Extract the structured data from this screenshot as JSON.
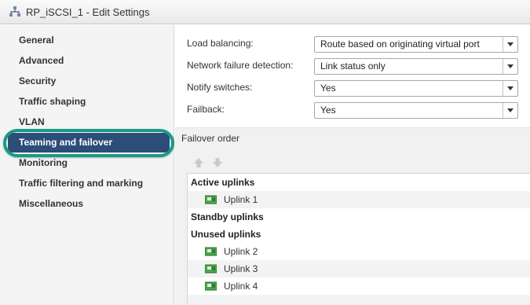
{
  "window": {
    "title": "RP_iSCSI_1 - Edit Settings",
    "icon": "network-portgroup-icon"
  },
  "sidebar": {
    "items": [
      {
        "label": "General"
      },
      {
        "label": "Advanced"
      },
      {
        "label": "Security"
      },
      {
        "label": "Traffic shaping"
      },
      {
        "label": "VLAN"
      },
      {
        "label": "Teaming and failover",
        "selected": true
      },
      {
        "label": "Monitoring"
      },
      {
        "label": "Traffic filtering and marking"
      },
      {
        "label": "Miscellaneous"
      }
    ],
    "selected_color": "#2b4d78",
    "highlight_color": "#1a9a86"
  },
  "settings": {
    "load_balancing": {
      "label": "Load balancing:",
      "value": "Route based on originating virtual port"
    },
    "network_failure_detection": {
      "label": "Network failure detection:",
      "value": "Link status only"
    },
    "notify_switches": {
      "label": "Notify switches:",
      "value": "Yes"
    },
    "failback": {
      "label": "Failback:",
      "value": "Yes"
    }
  },
  "failover": {
    "title": "Failover order",
    "move_up_icon": "arrow-up-icon",
    "move_down_icon": "arrow-down-icon",
    "groups": {
      "active": {
        "label": "Active uplinks",
        "uplinks": [
          "Uplink 1"
        ]
      },
      "standby": {
        "label": "Standby uplinks",
        "uplinks": []
      },
      "unused": {
        "label": "Unused uplinks",
        "uplinks": [
          "Uplink 2",
          "Uplink 3",
          "Uplink 4"
        ]
      }
    },
    "uplink_icon": "network-adapter-icon"
  }
}
